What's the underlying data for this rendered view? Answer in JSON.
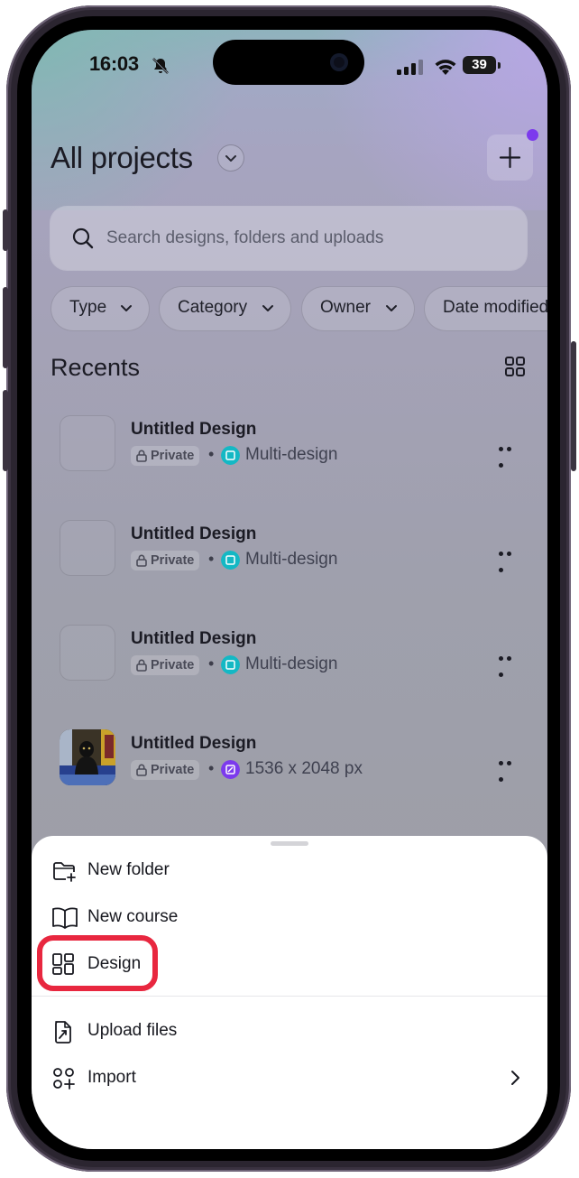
{
  "status_bar": {
    "time": "16:03",
    "battery": "39"
  },
  "header": {
    "title": "All projects"
  },
  "search": {
    "placeholder": "Search designs, folders and uploads"
  },
  "filters": [
    {
      "label": "Type"
    },
    {
      "label": "Category"
    },
    {
      "label": "Owner"
    },
    {
      "label": "Date modified"
    }
  ],
  "recents": {
    "heading": "Recents",
    "items": [
      {
        "title": "Untitled Design",
        "privacy": "Private",
        "type_label": "Multi-design",
        "badge_color": "#14b8c4"
      },
      {
        "title": "Untitled Design",
        "privacy": "Private",
        "type_label": "Multi-design",
        "badge_color": "#14b8c4"
      },
      {
        "title": "Untitled Design",
        "privacy": "Private",
        "type_label": "Multi-design",
        "badge_color": "#14b8c4"
      },
      {
        "title": "Untitled Design",
        "privacy": "Private",
        "type_label": "1536 x 2048 px",
        "badge_color": "#7c3aed"
      }
    ]
  },
  "sheet": {
    "items": [
      {
        "label": "New folder",
        "icon": "new-folder-icon"
      },
      {
        "label": "New course",
        "icon": "book-icon"
      },
      {
        "label": "Design",
        "icon": "layout-grid-icon"
      },
      {
        "label": "Upload files",
        "icon": "upload-file-icon"
      },
      {
        "label": "Import",
        "icon": "import-apps-icon"
      }
    ]
  },
  "colors": {
    "accent": "#7c3aed",
    "highlight": "#e8273f"
  }
}
